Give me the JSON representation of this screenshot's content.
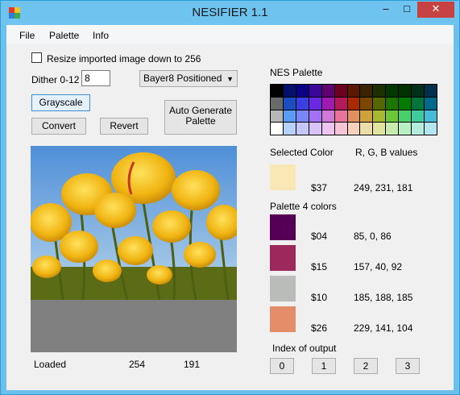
{
  "window": {
    "title": "NESIFIER 1.1"
  },
  "menu": {
    "file": "File",
    "palette": "Palette",
    "info": "Info"
  },
  "options": {
    "resize_label": "Resize imported image down to 256",
    "dither_label": "Dither 0-12",
    "dither_value": "8",
    "dither_mode": "Bayer8 Positioned"
  },
  "buttons": {
    "grayscale": "Grayscale",
    "convert": "Convert",
    "revert": "Revert",
    "auto_generate_line1": "Auto Generate",
    "auto_generate_line2": "Palette"
  },
  "status": {
    "state": "Loaded",
    "width": "254",
    "height": "191"
  },
  "nes_palette": {
    "title": "NES Palette",
    "colors": [
      "#000000",
      "#04106b",
      "#0a0085",
      "#3a0898",
      "#5e0070",
      "#6b0020",
      "#5a1a00",
      "#3a2400",
      "#1e3000",
      "#003800",
      "#003200",
      "#003016",
      "#002f4b",
      "#6a6a6a",
      "#1a4ec0",
      "#3b3fe0",
      "#6a28e0",
      "#9e1ab0",
      "#b41a5a",
      "#a82a00",
      "#7a4600",
      "#566600",
      "#1e7600",
      "#007a00",
      "#00743a",
      "#006a8a",
      "#b7b7b7",
      "#5a9cf5",
      "#7a86fa",
      "#a472f5",
      "#d07ad8",
      "#e8749c",
      "#e09060",
      "#cda23c",
      "#a8b630",
      "#6cc63a",
      "#4ad06a",
      "#40ca9e",
      "#46bcd8",
      "#ffffff",
      "#b6d2fa",
      "#c6c6fa",
      "#d8c2fa",
      "#eec4f0",
      "#f6c6d6",
      "#f6d2bc",
      "#ecdca6",
      "#e0e49e",
      "#c8ecae",
      "#b8f0c4",
      "#b4ecdc",
      "#b4e6f2"
    ]
  },
  "selected": {
    "label": "Selected Color",
    "rgb_header": "R, G, B values",
    "color": "#f9e7b5",
    "code": "$37",
    "rgb": "249, 231, 181"
  },
  "palette4": {
    "title": "Palette 4 colors",
    "entries": [
      {
        "color": "#550056",
        "code": "$04",
        "rgb": "85, 0, 86"
      },
      {
        "color": "#9d285c",
        "code": "$15",
        "rgb": "157, 40, 92"
      },
      {
        "color": "#b9bcb9",
        "code": "$10",
        "rgb": "185, 188, 185"
      },
      {
        "color": "#e58d68",
        "code": "$26",
        "rgb": "229, 141, 104"
      }
    ]
  },
  "index_output": {
    "title": "Index of output",
    "buttons": [
      "0",
      "1",
      "2",
      "3"
    ]
  }
}
